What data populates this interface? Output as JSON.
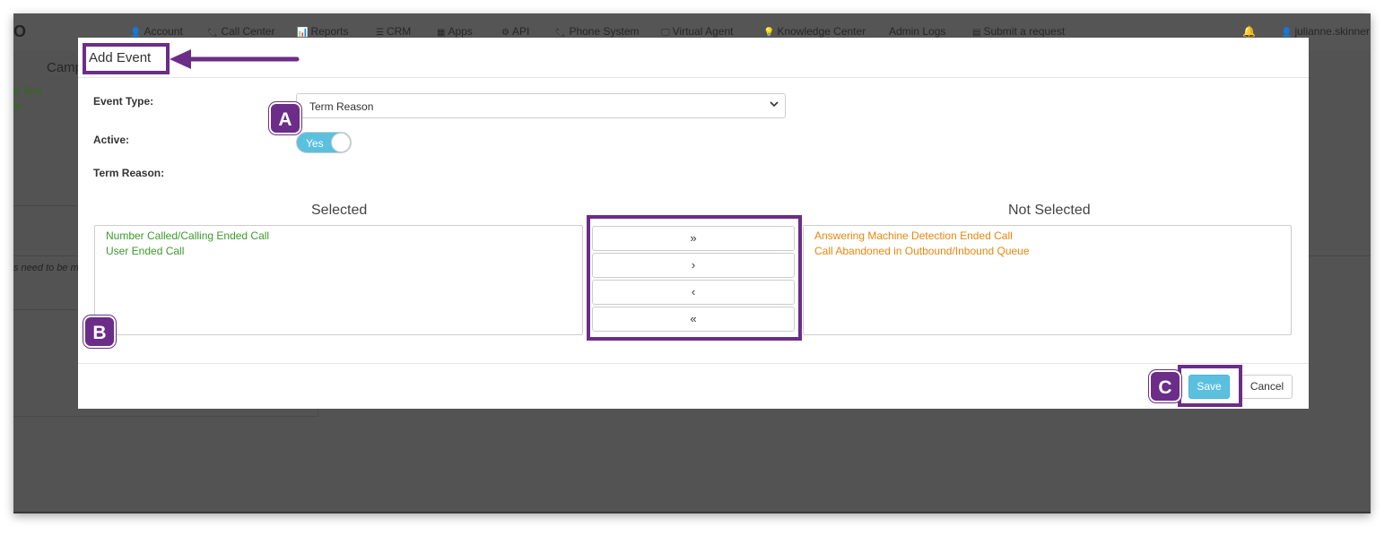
{
  "nav": {
    "logo": "O",
    "items": [
      {
        "icon": "user-icon",
        "glyph": "👤",
        "label": "Account"
      },
      {
        "icon": "phone-icon",
        "glyph": "📞",
        "label": "Call Center"
      },
      {
        "icon": "bar-chart-icon",
        "glyph": "📊",
        "label": "Reports"
      },
      {
        "icon": "list-icon",
        "glyph": "☰",
        "label": "CRM"
      },
      {
        "icon": "grid-icon",
        "glyph": "▦",
        "label": "Apps"
      },
      {
        "icon": "gear-icon",
        "glyph": "⚙",
        "label": "API"
      },
      {
        "icon": "phone-icon",
        "glyph": "📞",
        "label": "Phone System"
      },
      {
        "icon": "monitor-icon",
        "glyph": "🖵",
        "label": "Virtual Agent"
      },
      {
        "icon": "lightbulb-icon",
        "glyph": "💡",
        "label": "Knowledge Center"
      },
      {
        "icon": "",
        "glyph": "",
        "label": "Admin Logs"
      },
      {
        "icon": "ticket-icon",
        "glyph": "▤",
        "label": "Submit a request"
      }
    ],
    "bell_glyph": "🔔",
    "user_glyph": "👤",
    "user": "julianne.skinner"
  },
  "background": {
    "camp_label": "Camp",
    "link1": "e Test",
    "link2": "al",
    "note": "s need to be m"
  },
  "modal": {
    "title": "Add Event",
    "event_type_label": "Event Type:",
    "event_type_value": "Term Reason",
    "active_label": "Active:",
    "active_value": "Yes",
    "term_reason_label": "Term Reason:",
    "selected_heading": "Selected",
    "not_selected_heading": "Not Selected",
    "selected_items": [
      "Number Called/Calling Ended Call",
      "User Ended Call"
    ],
    "not_selected_items": [
      "Answering Machine Detection Ended Call",
      "Call Abandoned in Outbound/Inbound Queue"
    ],
    "move_buttons": [
      {
        "name": "move-all-right-button",
        "glyph": "»"
      },
      {
        "name": "move-right-button",
        "glyph": "›"
      },
      {
        "name": "move-left-button",
        "glyph": "‹"
      },
      {
        "name": "move-all-left-button",
        "glyph": "«"
      }
    ],
    "save_label": "Save",
    "cancel_label": "Cancel"
  },
  "annotations": {
    "a": "A",
    "b": "B",
    "c": "C",
    "color": "#6b2d87"
  }
}
